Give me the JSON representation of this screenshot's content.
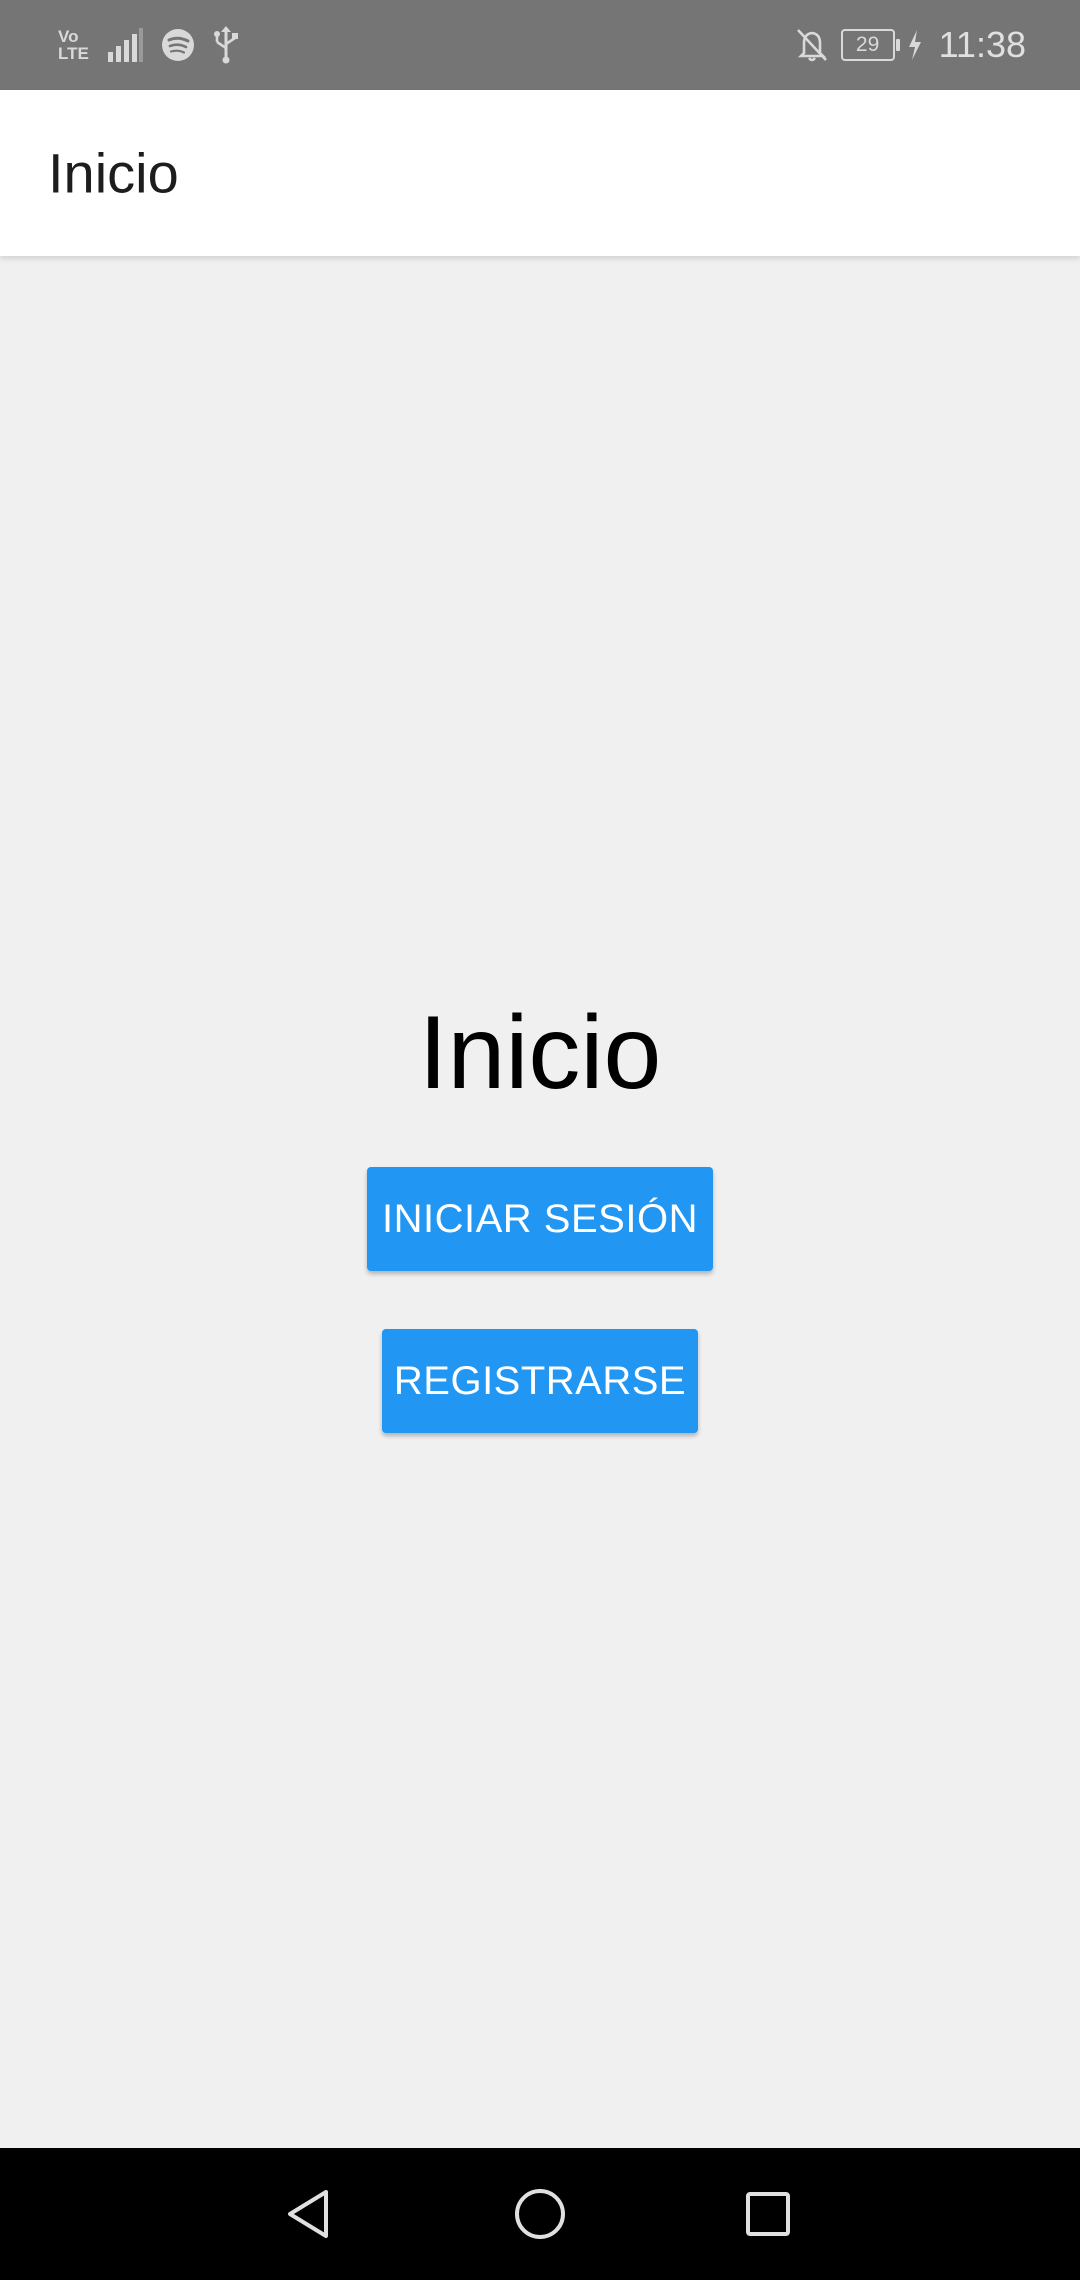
{
  "status_bar": {
    "network_label_top": "Vo",
    "network_label_bottom": "LTE",
    "battery_level": "29",
    "time": "11:38",
    "icons": [
      "volte-icon",
      "signal-icon",
      "spotify-icon",
      "usb-icon",
      "notifications-off-icon",
      "battery-icon",
      "charging-icon"
    ]
  },
  "app_bar": {
    "title": "Inicio"
  },
  "main": {
    "heading": "Inicio",
    "login_button": "INICIAR SESIÓN",
    "register_button": "REGISTRARSE"
  },
  "colors": {
    "status_bar": "#757575",
    "background": "#f0f0f1",
    "button": "#2196f3",
    "button_text": "#ffffff"
  },
  "nav_bar": {
    "icons": [
      "back-icon",
      "home-icon",
      "recents-icon"
    ]
  }
}
